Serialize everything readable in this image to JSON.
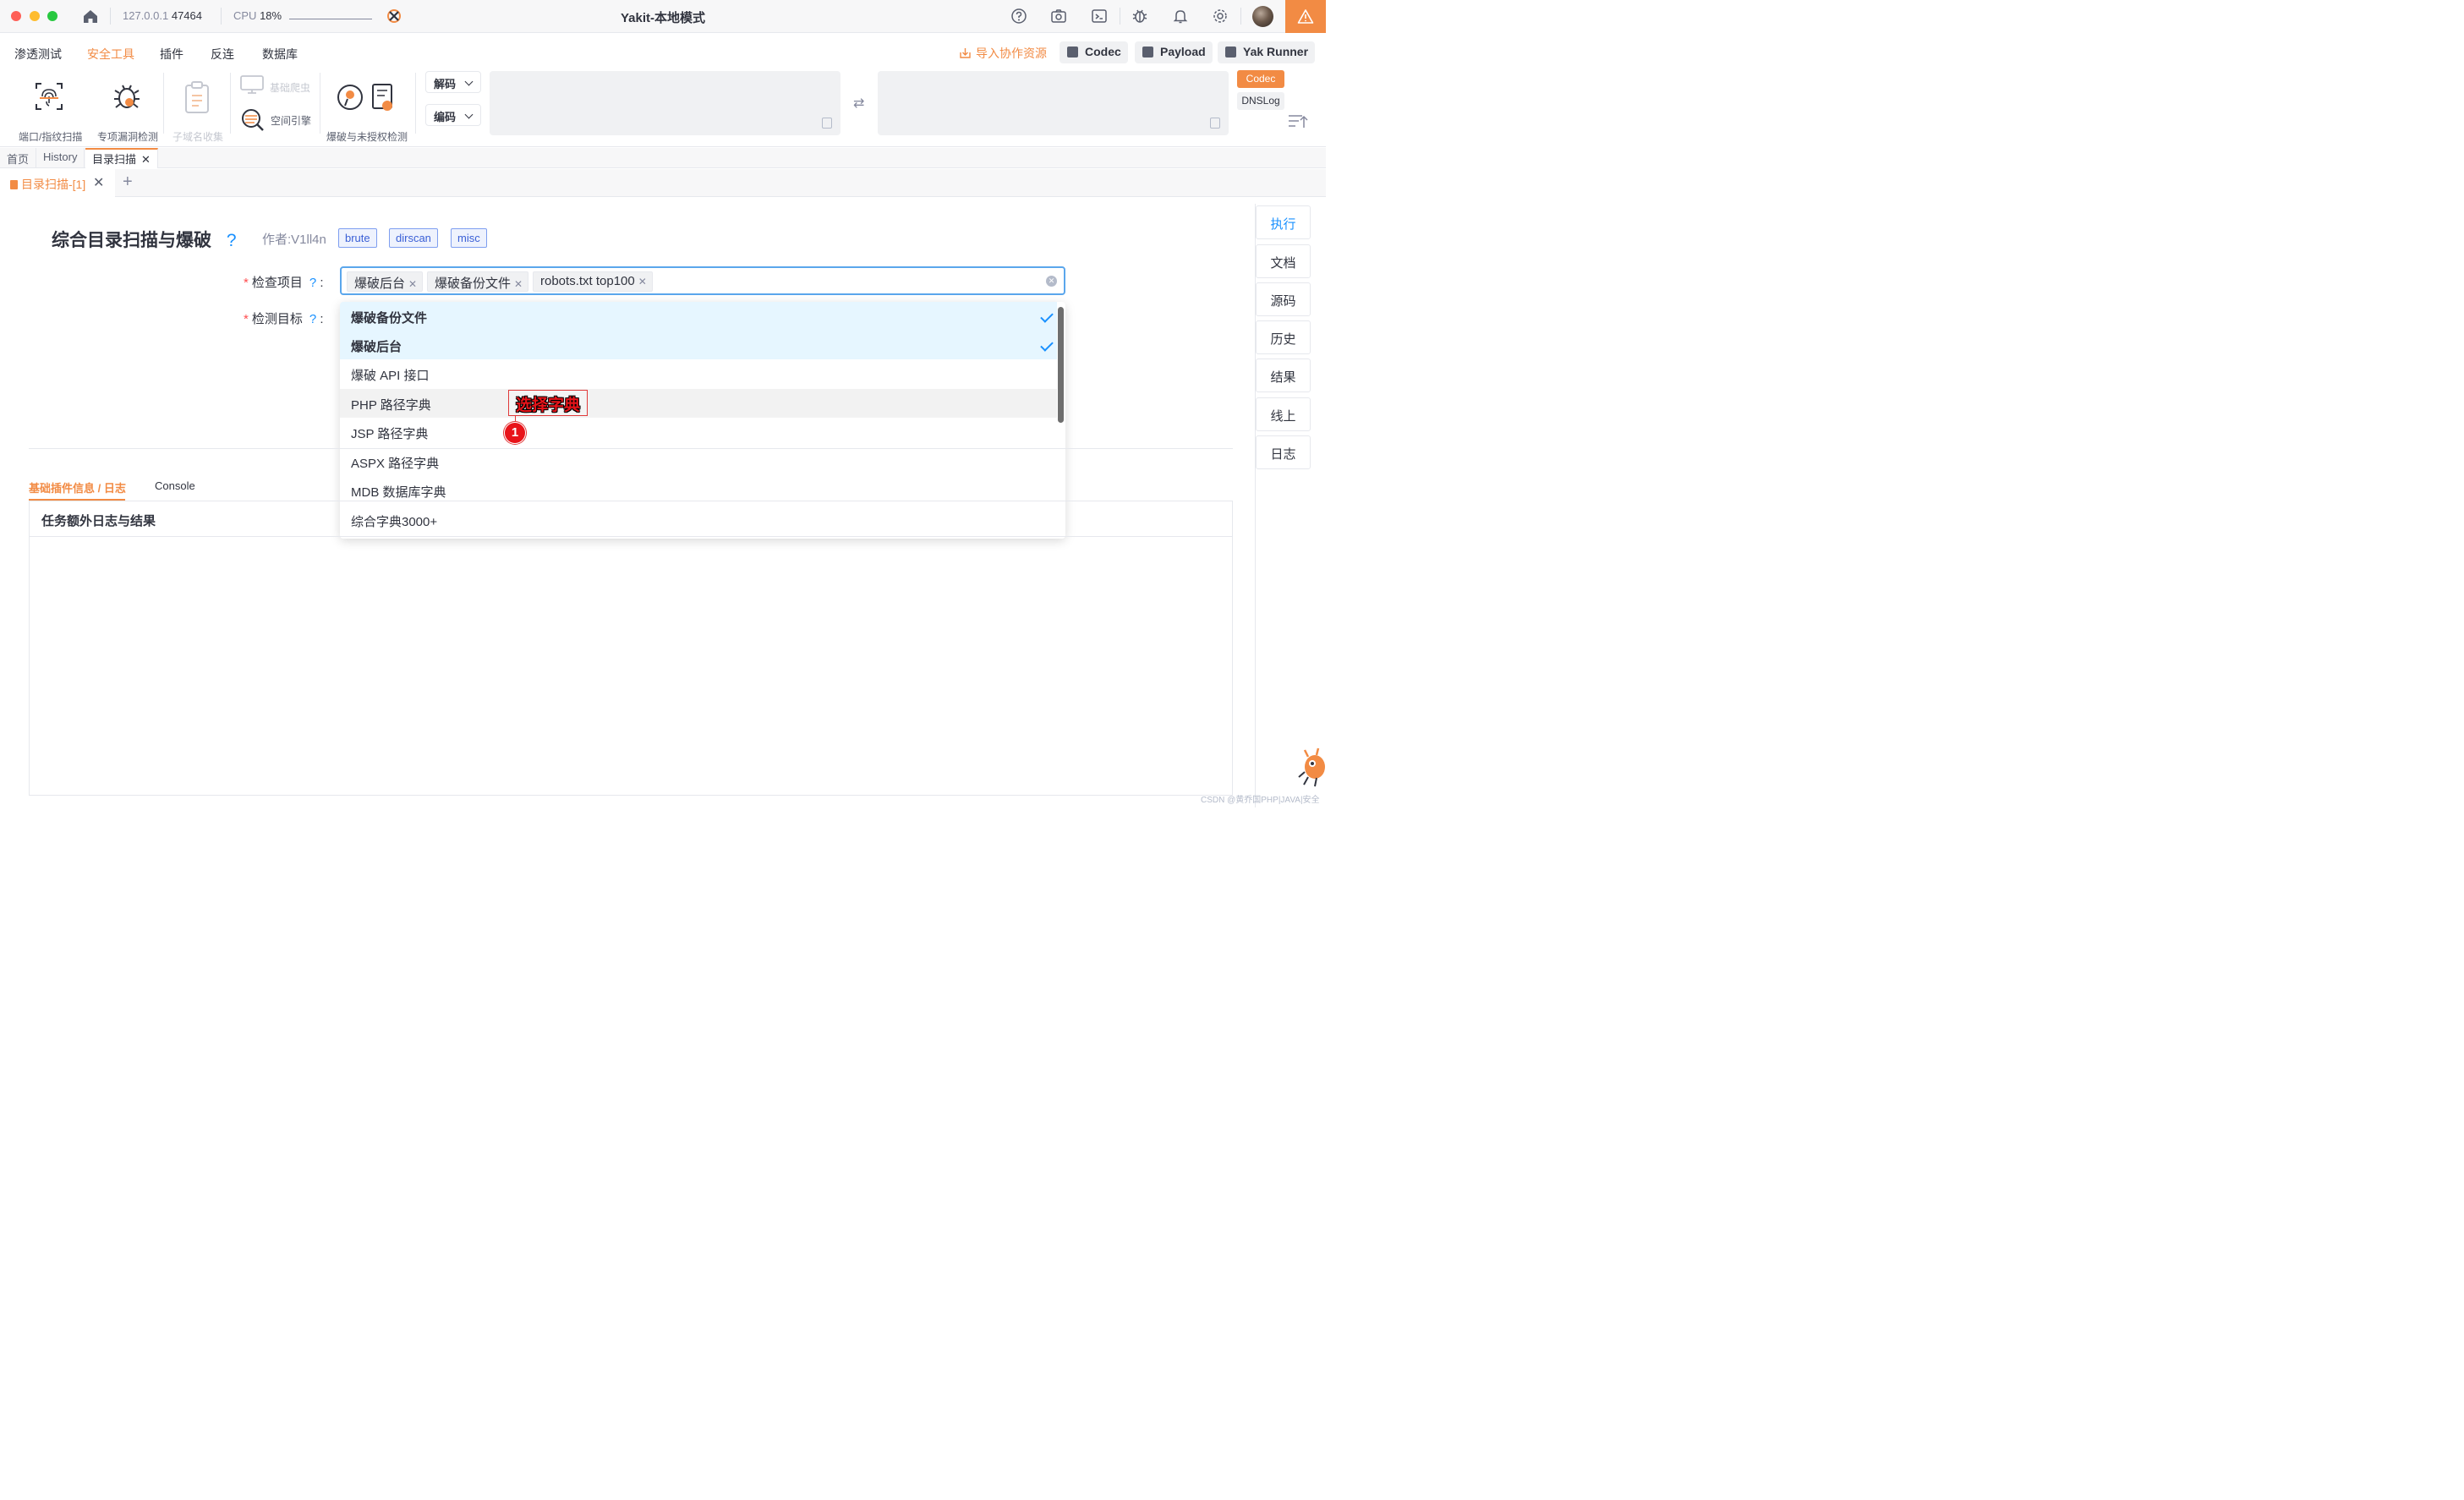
{
  "titlebar": {
    "host": "127.0.0.1",
    "port": "47464",
    "cpu_label": "CPU",
    "cpu_value": "18%",
    "app_title": "Yakit-本地模式"
  },
  "menu": {
    "items": [
      "渗透测试",
      "安全工具",
      "插件",
      "反连",
      "数据库"
    ],
    "active": "安全工具",
    "import_label": "导入协作资源",
    "right_buttons": [
      "Codec",
      "Payload",
      "Yak Runner"
    ]
  },
  "tools": {
    "port_scan": "端口/指纹扫描",
    "vuln_check": "专项漏洞检测",
    "subdomain": "子域名收集",
    "crawler": "基础爬虫",
    "space_engine": "空间引擎",
    "brute": "爆破与未授权检测",
    "decode_label": "解码",
    "encode_label": "编码",
    "codec_tag": "Codec",
    "dnslog_tag": "DNSLog"
  },
  "page_tabs": [
    "首页",
    "History",
    "目录扫描"
  ],
  "sub_tab": {
    "label": "目录扫描-[1]"
  },
  "plugin": {
    "title": "综合目录扫描与爆破",
    "help": "?",
    "author": "作者:V1ll4n",
    "tags": [
      "brute",
      "dirscan",
      "misc"
    ]
  },
  "form": {
    "field1_label": "检查项目",
    "field2_label": "检测目标",
    "help": "?",
    "colon": ":",
    "selected_chips": [
      "爆破后台",
      "爆破备份文件",
      "robots.txt top100"
    ]
  },
  "dropdown": {
    "options": [
      {
        "label": "爆破备份文件",
        "selected": true
      },
      {
        "label": "爆破后台",
        "selected": true
      },
      {
        "label": "爆破 API 接口",
        "selected": false
      },
      {
        "label": "PHP 路径字典",
        "selected": false,
        "hover": true
      },
      {
        "label": "JSP 路径字典",
        "selected": false
      },
      {
        "label": "ASPX 路径字典",
        "selected": false
      },
      {
        "label": "MDB 数据库字典",
        "selected": false
      },
      {
        "label": "综合字典3000+",
        "selected": false
      }
    ]
  },
  "annotation": {
    "label": "选择字典",
    "number": "1"
  },
  "bottom": {
    "tab_active": "基础插件信息 / 日志",
    "tab_console": "Console",
    "panel_title": "任务额外日志与结果"
  },
  "side_actions": [
    "执行",
    "文档",
    "源码",
    "历史",
    "结果",
    "线上",
    "日志"
  ],
  "watermark": "CSDN @黄乔国PHP|JAVA|安全",
  "colors": {
    "accent": "#f28b44",
    "primary_blue": "#1890ff",
    "selected_bg": "#e6f6ff"
  }
}
